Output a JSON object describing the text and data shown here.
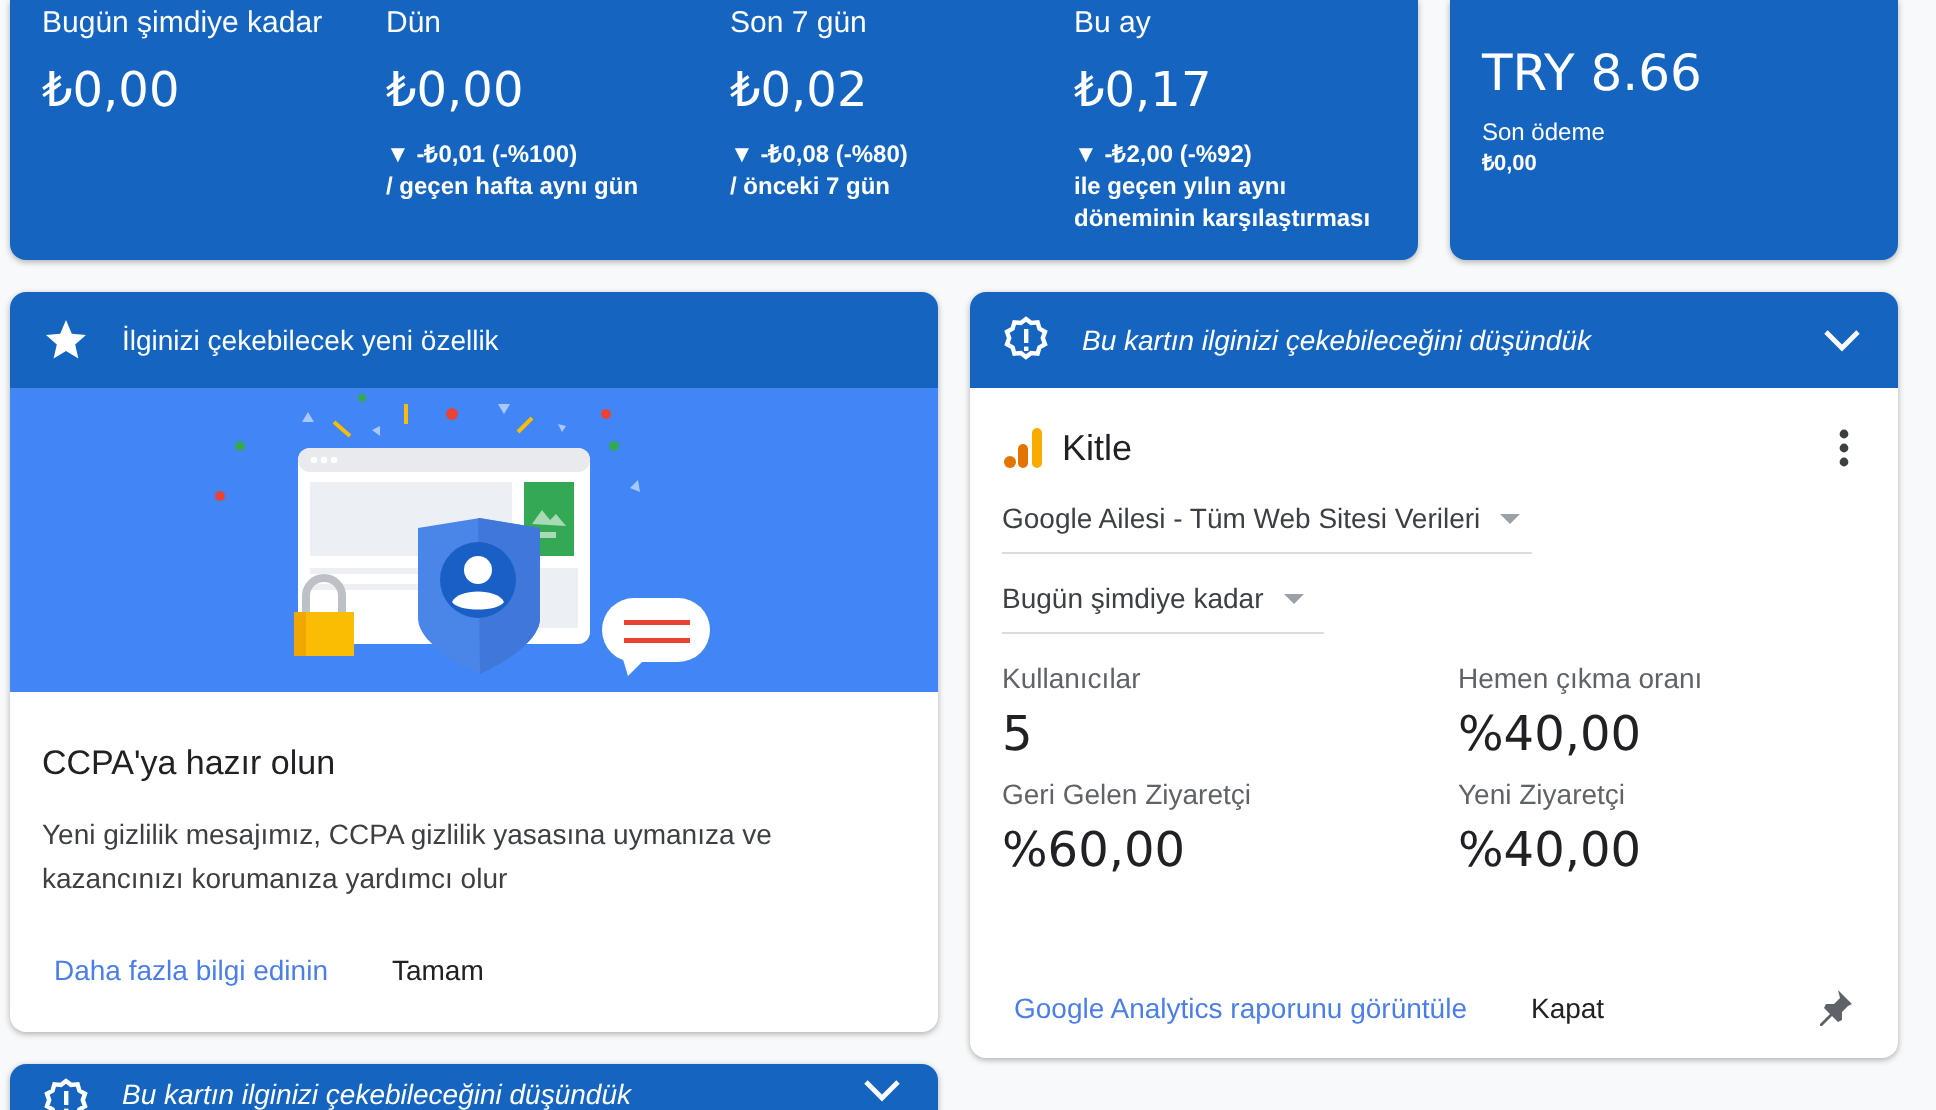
{
  "earnings": [
    {
      "label": "Bugün şimdiye kadar",
      "value": "₺0,00"
    },
    {
      "label": "Dün",
      "value": "₺0,00",
      "change": "▼ -₺0,01 (-%100)",
      "comparison": "/ geçen hafta aynı gün"
    },
    {
      "label": "Son 7 gün",
      "value": "₺0,02",
      "change": "▼ -₺0,08 (-%80)",
      "comparison": "/ önceki 7 gün"
    },
    {
      "label": "Bu ay",
      "value": "₺0,17",
      "change": "▼ -₺2,00 (-%92)",
      "comparison": "ile geçen yılın aynı döneminin karşılaştırması"
    }
  ],
  "payment": {
    "amount": "TRY 8.66",
    "label": "Son ödeme",
    "value": "₺0,00"
  },
  "feature_card": {
    "header": "İlginizi çekebilecek yeni özellik",
    "heading": "CCPA'ya hazır olun",
    "body": "Yeni gizlilik mesajımız, CCPA gizlilik yasasına uymanıza ve kazancınızı korumanıza yardımcı olur",
    "actions": [
      {
        "label": "Daha fazla bilgi edinin",
        "kind": "link"
      },
      {
        "label": "Tamam",
        "kind": "button"
      }
    ]
  },
  "suggestion_card": {
    "header": "Bu kartın ilginizi çekebileceğini düşündük",
    "expanded": true,
    "title": "Kitle",
    "property": "Google Ailesi - Tüm Web Sitesi Verileri",
    "period": "Bugün şimdiye kadar",
    "metrics": [
      {
        "label": "Kullanıcılar",
        "value": "5"
      },
      {
        "label": "Hemen çıkma oranı",
        "value": "%40,00"
      },
      {
        "label": "Geri Gelen Ziyaretçi",
        "value": "%60,00"
      },
      {
        "label": "Yeni Ziyaretçi",
        "value": "%40,00"
      }
    ],
    "actions": [
      {
        "label": "Google Analytics raporunu görüntüle",
        "kind": "link"
      },
      {
        "label": "Kapat",
        "kind": "button"
      }
    ]
  },
  "bottom_card": {
    "header": "Bu kartın ilginizi çekebileceğini düşündük",
    "expanded": true
  }
}
